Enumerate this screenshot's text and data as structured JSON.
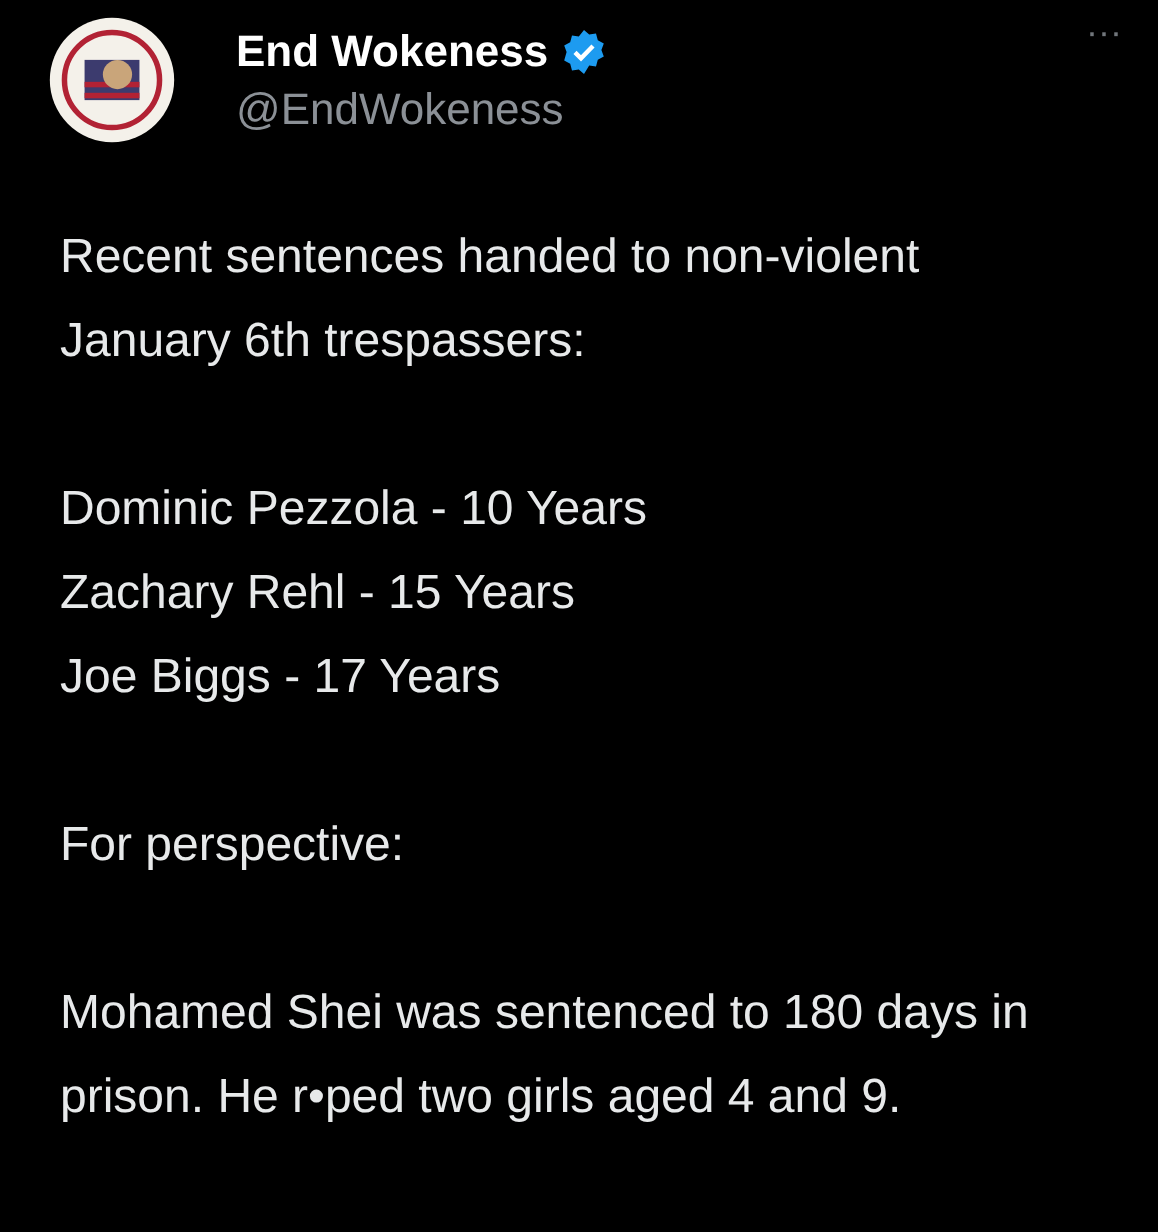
{
  "author": {
    "name": "End Wokeness",
    "verified": true,
    "handle": "@EndWokeness"
  },
  "more_menu": "···",
  "body": [
    {
      "kind": "paragraph",
      "text": "Recent sentences handed to non-violent January 6th trespassers:"
    },
    {
      "kind": "lines",
      "lines": [
        "Dominic Pezzola - 10 Years",
        "Zachary Rehl - 15 Years",
        "Joe Biggs - 17 Years"
      ]
    },
    {
      "kind": "paragraph",
      "text": "For perspective:"
    },
    {
      "kind": "paragraph",
      "text": "Mohamed Shei was sentenced to 180 days in prison. He r•ped two girls aged 4 and 9."
    }
  ]
}
